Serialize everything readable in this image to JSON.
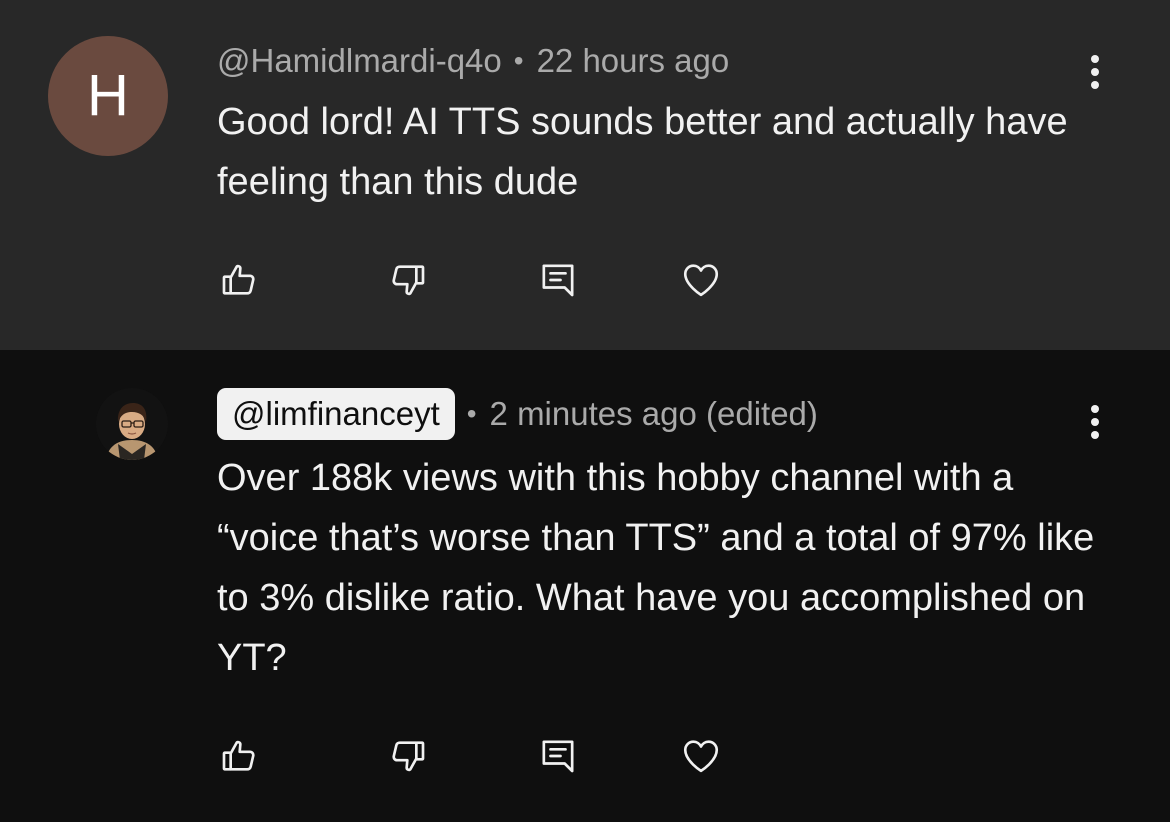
{
  "comments": [
    {
      "avatar_letter": "H",
      "avatar_color": "#6a4a3f",
      "handle": "@Hamidlmardi-q4o",
      "separator": "•",
      "time": "22 hours ago",
      "text": "Good lord! AI TTS sounds better and actually have feeling than this dude",
      "actions": [
        "like-icon",
        "dislike-icon",
        "reply-icon",
        "heart-icon"
      ]
    },
    {
      "avatar_image": "profile-photo",
      "handle": "@limfinanceyt",
      "handle_highlighted": true,
      "separator": "•",
      "time": "2 minutes ago (edited)",
      "text": "Over 188k views with this hobby channel with a “voice that’s worse than TTS” and a total of 97% like to 3% dislike ratio. What have you accomplished on YT?",
      "actions": [
        "like-icon",
        "dislike-icon",
        "reply-icon",
        "heart-icon"
      ]
    }
  ],
  "colors": {
    "first_comment_bg": "#282828",
    "second_comment_bg": "#0f0f0f",
    "meta_text": "#aaaaaa",
    "body_text": "#f1f1f1"
  }
}
